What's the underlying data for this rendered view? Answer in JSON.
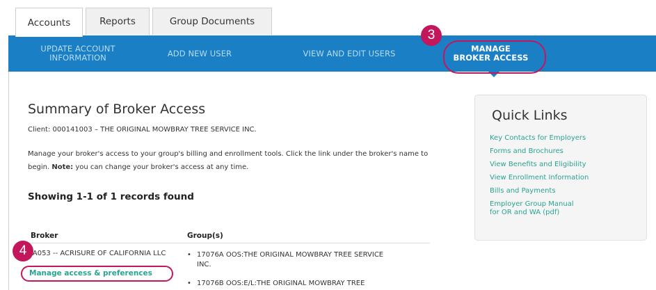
{
  "tabs": [
    {
      "label": "Accounts",
      "active": true
    },
    {
      "label": "Reports",
      "active": false
    },
    {
      "label": "Group Documents",
      "active": false
    }
  ],
  "nav": {
    "items": [
      {
        "label": "UPDATE ACCOUNT INFORMATION"
      },
      {
        "label": "ADD NEW USER"
      },
      {
        "label": "VIEW AND EDIT USERS"
      },
      {
        "label": "MANAGE BROKER ACCESS",
        "active": true
      }
    ]
  },
  "annotations": {
    "step_nav": "3",
    "step_link": "4",
    "highlight_color": "#c2185b"
  },
  "content": {
    "title": "Summary of Broker Access",
    "client": "Client: 000141003 – THE ORIGINAL MOWBRAY TREE SERVICE INC.",
    "description_prefix": "Manage your broker's access to your group's billing and enrollment tools. Click the link under the broker's name to begin.",
    "note_label": "Note:",
    "note_text": " you can change your broker's access at any time.",
    "records_text": "Showing 1-1 of 1 records found",
    "table": {
      "headers": [
        "Broker",
        "Group(s)"
      ],
      "rows": [
        {
          "broker": "BA053 -- ACRISURE OF CALIFORNIA LLC",
          "link": "Manage access & preferences",
          "groups": [
            "17076A  OOS:THE ORIGINAL MOWBRAY TREE SERVICE INC.",
            "17076B  OOS:E/L:THE ORIGINAL MOWBRAY TREE"
          ]
        }
      ]
    }
  },
  "quick_links": {
    "title": "Quick Links",
    "links": [
      "Key Contacts for Employers",
      "Forms and Brochures",
      "View Benefits and Eligibility",
      "View Enrollment Information",
      "Bills and Payments",
      "Employer Group Manual",
      "for OR and WA (pdf)"
    ]
  },
  "colors": {
    "nav_bar": "#1a7fc4",
    "link": "#2aa391",
    "annotation": "#c2185b"
  }
}
